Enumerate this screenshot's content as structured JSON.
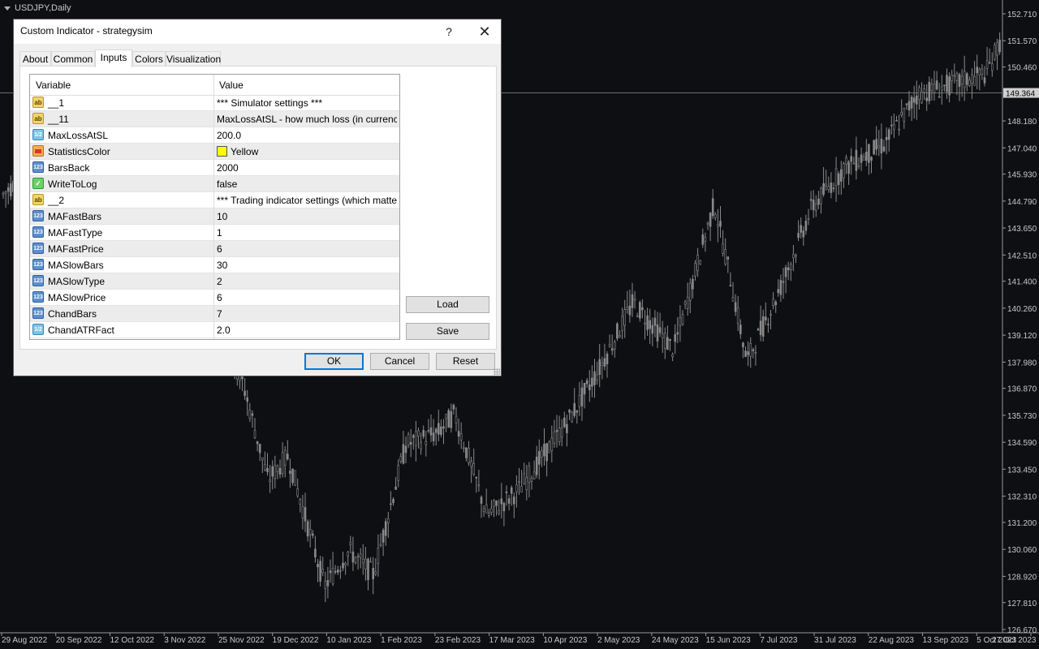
{
  "chart": {
    "symbol_label": "USDJPY,Daily",
    "current_price": "149.364",
    "price_axis": [
      "152.710",
      "151.570",
      "150.460",
      "149.364",
      "148.180",
      "147.040",
      "145.930",
      "144.790",
      "143.650",
      "142.510",
      "141.400",
      "140.260",
      "139.120",
      "137.980",
      "136.870",
      "135.730",
      "134.590",
      "133.450",
      "132.310",
      "131.200",
      "130.060",
      "128.920",
      "127.810",
      "126.670"
    ],
    "time_axis": [
      "29 Aug 2022",
      "20 Sep 2022",
      "12 Oct 2022",
      "3 Nov 2022",
      "25 Nov 2022",
      "19 Dec 2022",
      "10 Jan 2023",
      "1 Feb 2023",
      "23 Feb 2023",
      "17 Mar 2023",
      "10 Apr 2023",
      "2 May 2023",
      "24 May 2023",
      "15 Jun 2023",
      "7 Jul 2023",
      "31 Jul 2023",
      "22 Aug 2023",
      "13 Sep 2023",
      "5 Oct 2023",
      "27 Oct 2023"
    ],
    "colors": {
      "background": "#0e0f12",
      "candle": "#8a8a8a",
      "price_line": "#6e6e6e",
      "axis_text": "#c8c8c8"
    }
  },
  "dialog": {
    "title": "Custom Indicator - strategysim",
    "help_label": "?",
    "close_label": "✕",
    "tabs": [
      {
        "label": "About"
      },
      {
        "label": "Common"
      },
      {
        "label": "Inputs",
        "active": true
      },
      {
        "label": "Colors"
      },
      {
        "label": "Visualization"
      }
    ],
    "grid": {
      "col_variable": "Variable",
      "col_value": "Value",
      "rows": [
        {
          "icon": "ab",
          "icon_label": "ab",
          "name": "__1",
          "value": "*** Simulator settings ***"
        },
        {
          "icon": "ab",
          "icon_label": "ab",
          "name": "__11",
          "value": "MaxLossAtSL - how much loss (in currency) ..."
        },
        {
          "icon": "dbl",
          "icon_label": "1/2",
          "name": "MaxLossAtSL",
          "value": "200.0"
        },
        {
          "icon": "col",
          "icon_label": "",
          "name": "StatisticsColor",
          "value": "Yellow",
          "swatch": "#ffff00"
        },
        {
          "icon": "int",
          "icon_label": "123",
          "name": "BarsBack",
          "value": "2000"
        },
        {
          "icon": "bool",
          "icon_label": "✓",
          "name": "WriteToLog",
          "value": "false"
        },
        {
          "icon": "ab",
          "icon_label": "ab",
          "name": "__2",
          "value": "*** Trading indicator settings (which matter fo..."
        },
        {
          "icon": "int",
          "icon_label": "123",
          "name": "MAFastBars",
          "value": "10"
        },
        {
          "icon": "int",
          "icon_label": "123",
          "name": "MAFastType",
          "value": "1"
        },
        {
          "icon": "int",
          "icon_label": "123",
          "name": "MAFastPrice",
          "value": "6"
        },
        {
          "icon": "int",
          "icon_label": "123",
          "name": "MASlowBars",
          "value": "30"
        },
        {
          "icon": "int",
          "icon_label": "123",
          "name": "MASlowType",
          "value": "2"
        },
        {
          "icon": "int",
          "icon_label": "123",
          "name": "MASlowPrice",
          "value": "6"
        },
        {
          "icon": "int",
          "icon_label": "123",
          "name": "ChandBars",
          "value": "7"
        },
        {
          "icon": "dbl",
          "icon_label": "1/2",
          "name": "ChandATRFact",
          "value": "2.0"
        }
      ]
    },
    "buttons": {
      "load": "Load",
      "save": "Save",
      "ok": "OK",
      "cancel": "Cancel",
      "reset": "Reset"
    }
  }
}
